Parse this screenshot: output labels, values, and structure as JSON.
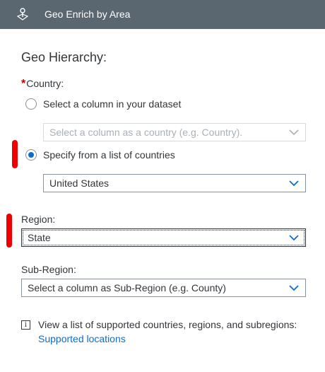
{
  "header": {
    "title": "Geo Enrich by Area",
    "icon": "geo-pin-icon"
  },
  "geo_hierarchy": {
    "title": "Geo Hierarchy:",
    "country": {
      "required_marker": "*",
      "label": "Country:",
      "option_column": {
        "label": "Select a column in your dataset",
        "checked": false
      },
      "column_select": {
        "placeholder": "Select a column as a country (e.g. Country).",
        "disabled": true
      },
      "option_list": {
        "label": "Specify from a list of countries",
        "checked": true
      },
      "list_select": {
        "value": "United States"
      }
    },
    "region": {
      "label": "Region:",
      "select": {
        "value": "State"
      }
    },
    "sub_region": {
      "label": "Sub-Region:",
      "select": {
        "value": "Select a column as Sub-Region (e.g. County)"
      }
    }
  },
  "info": {
    "icon": "info-icon",
    "glyph": "i",
    "text": "View a list of supported countries, regions, and subregions:",
    "link_label": "Supported locations"
  },
  "colors": {
    "header_bg": "#5b6770",
    "accent": "#0a6ed1",
    "required": "#bb0000",
    "annotation_mark": "#ee0000"
  }
}
